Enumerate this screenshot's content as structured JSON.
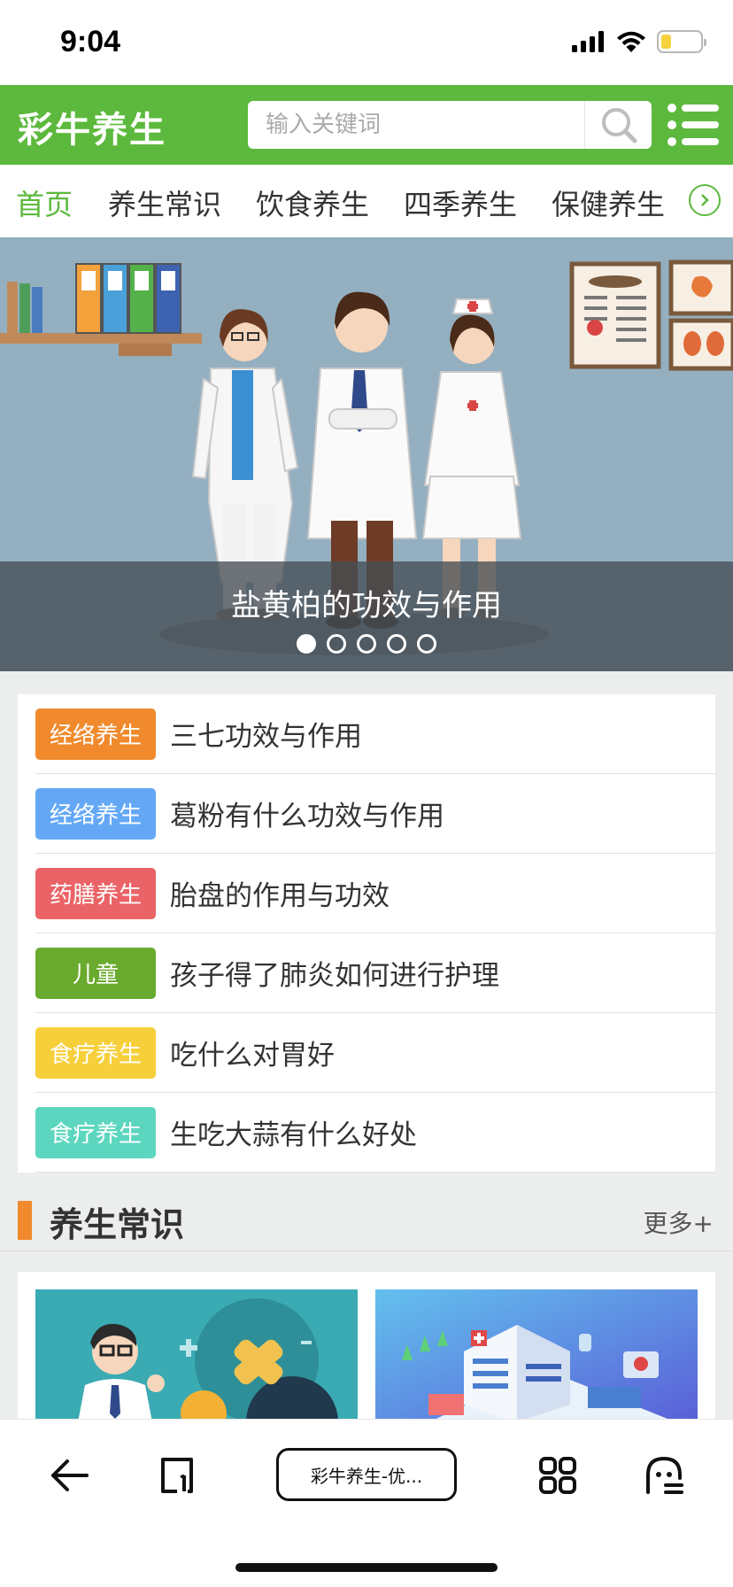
{
  "status_bar": {
    "time": "9:04",
    "icons": [
      "signal-icon",
      "wifi-icon",
      "battery-icon"
    ],
    "battery_level": 0.25
  },
  "header": {
    "logo": "彩牛养生",
    "search_placeholder": "输入关键词",
    "brand_color": "#5cb93d"
  },
  "nav": {
    "items": [
      "首页",
      "养生常识",
      "饮食养生",
      "四季养生",
      "保健养生"
    ],
    "active_index": 0
  },
  "banner": {
    "caption": "盐黄柏的功效与作用",
    "slide_count": 5,
    "active_slide": 0
  },
  "news": [
    {
      "tag": "经络养生",
      "tag_color": "#f08a2c",
      "title": "三七功效与作用"
    },
    {
      "tag": "经络养生",
      "tag_color": "#64a8f5",
      "title": "葛粉有什么功效与作用"
    },
    {
      "tag": "药膳养生",
      "tag_color": "#ea6366",
      "title": "胎盘的作用与功效"
    },
    {
      "tag": "儿童",
      "tag_color": "#6aaa2e",
      "title": "孩子得了肺炎如何进行护理"
    },
    {
      "tag": "食疗养生",
      "tag_color": "#f6cf3a",
      "title": "吃什么对胃好"
    },
    {
      "tag": "食疗养生",
      "tag_color": "#5cd6be",
      "title": "生吃大蒜有什么好处"
    }
  ],
  "section": {
    "title": "养生常识",
    "more": "更多+",
    "accent_color": "#f08a2c"
  },
  "toolbar": {
    "tab_title": "彩牛养生-优..."
  }
}
